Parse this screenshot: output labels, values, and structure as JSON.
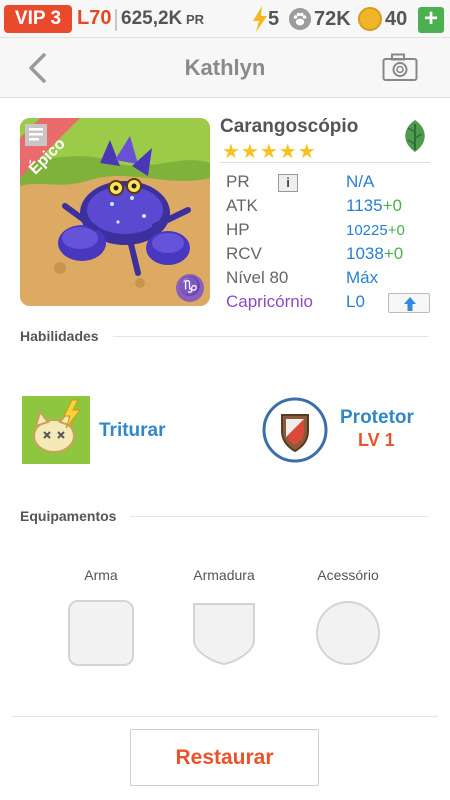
{
  "status_bar": {
    "vip": "VIP 3",
    "level": "L70",
    "pr_value": "625,2K",
    "pr_unit": "PR",
    "energy": "5",
    "paws": "72K",
    "coins": "40",
    "add_label": "+"
  },
  "header": {
    "title": "Kathlyn",
    "icons": [
      "back-arrow-icon",
      "camera-icon"
    ]
  },
  "pet": {
    "name": "Carangoscópio",
    "rarity": "Épico",
    "stars": "★★★★★",
    "element_icon": "leaf-icon",
    "stats": [
      {
        "label": "PR",
        "value": "N/A",
        "plus": ""
      },
      {
        "label": "ATK",
        "value": "1135",
        "plus": "+0"
      },
      {
        "label": "HP",
        "value": "10225",
        "plus": "+0"
      },
      {
        "label": "RCV",
        "value": "1038",
        "plus": "+0"
      },
      {
        "label": "Nível 80",
        "value": "Máx",
        "plus": ""
      },
      {
        "label": "Capricórnio",
        "value": "L0",
        "plus": ""
      }
    ],
    "info_label": "i"
  },
  "abilities": {
    "title": "Habilidades",
    "skill": "Triturar",
    "trait": "Protetor",
    "trait_level": "LV 1"
  },
  "equipment": {
    "title": "Equipamentos",
    "slots": [
      "Arma",
      "Armadura",
      "Acessório"
    ]
  },
  "footer": {
    "restore_label": "Restaurar"
  },
  "colors": {
    "accent_orange": "#e8542a",
    "link_blue": "#3287c6",
    "stat_blue": "#2a7fd0",
    "plus_green": "#4caf50",
    "zodiac_purple": "#8a4cc2"
  }
}
